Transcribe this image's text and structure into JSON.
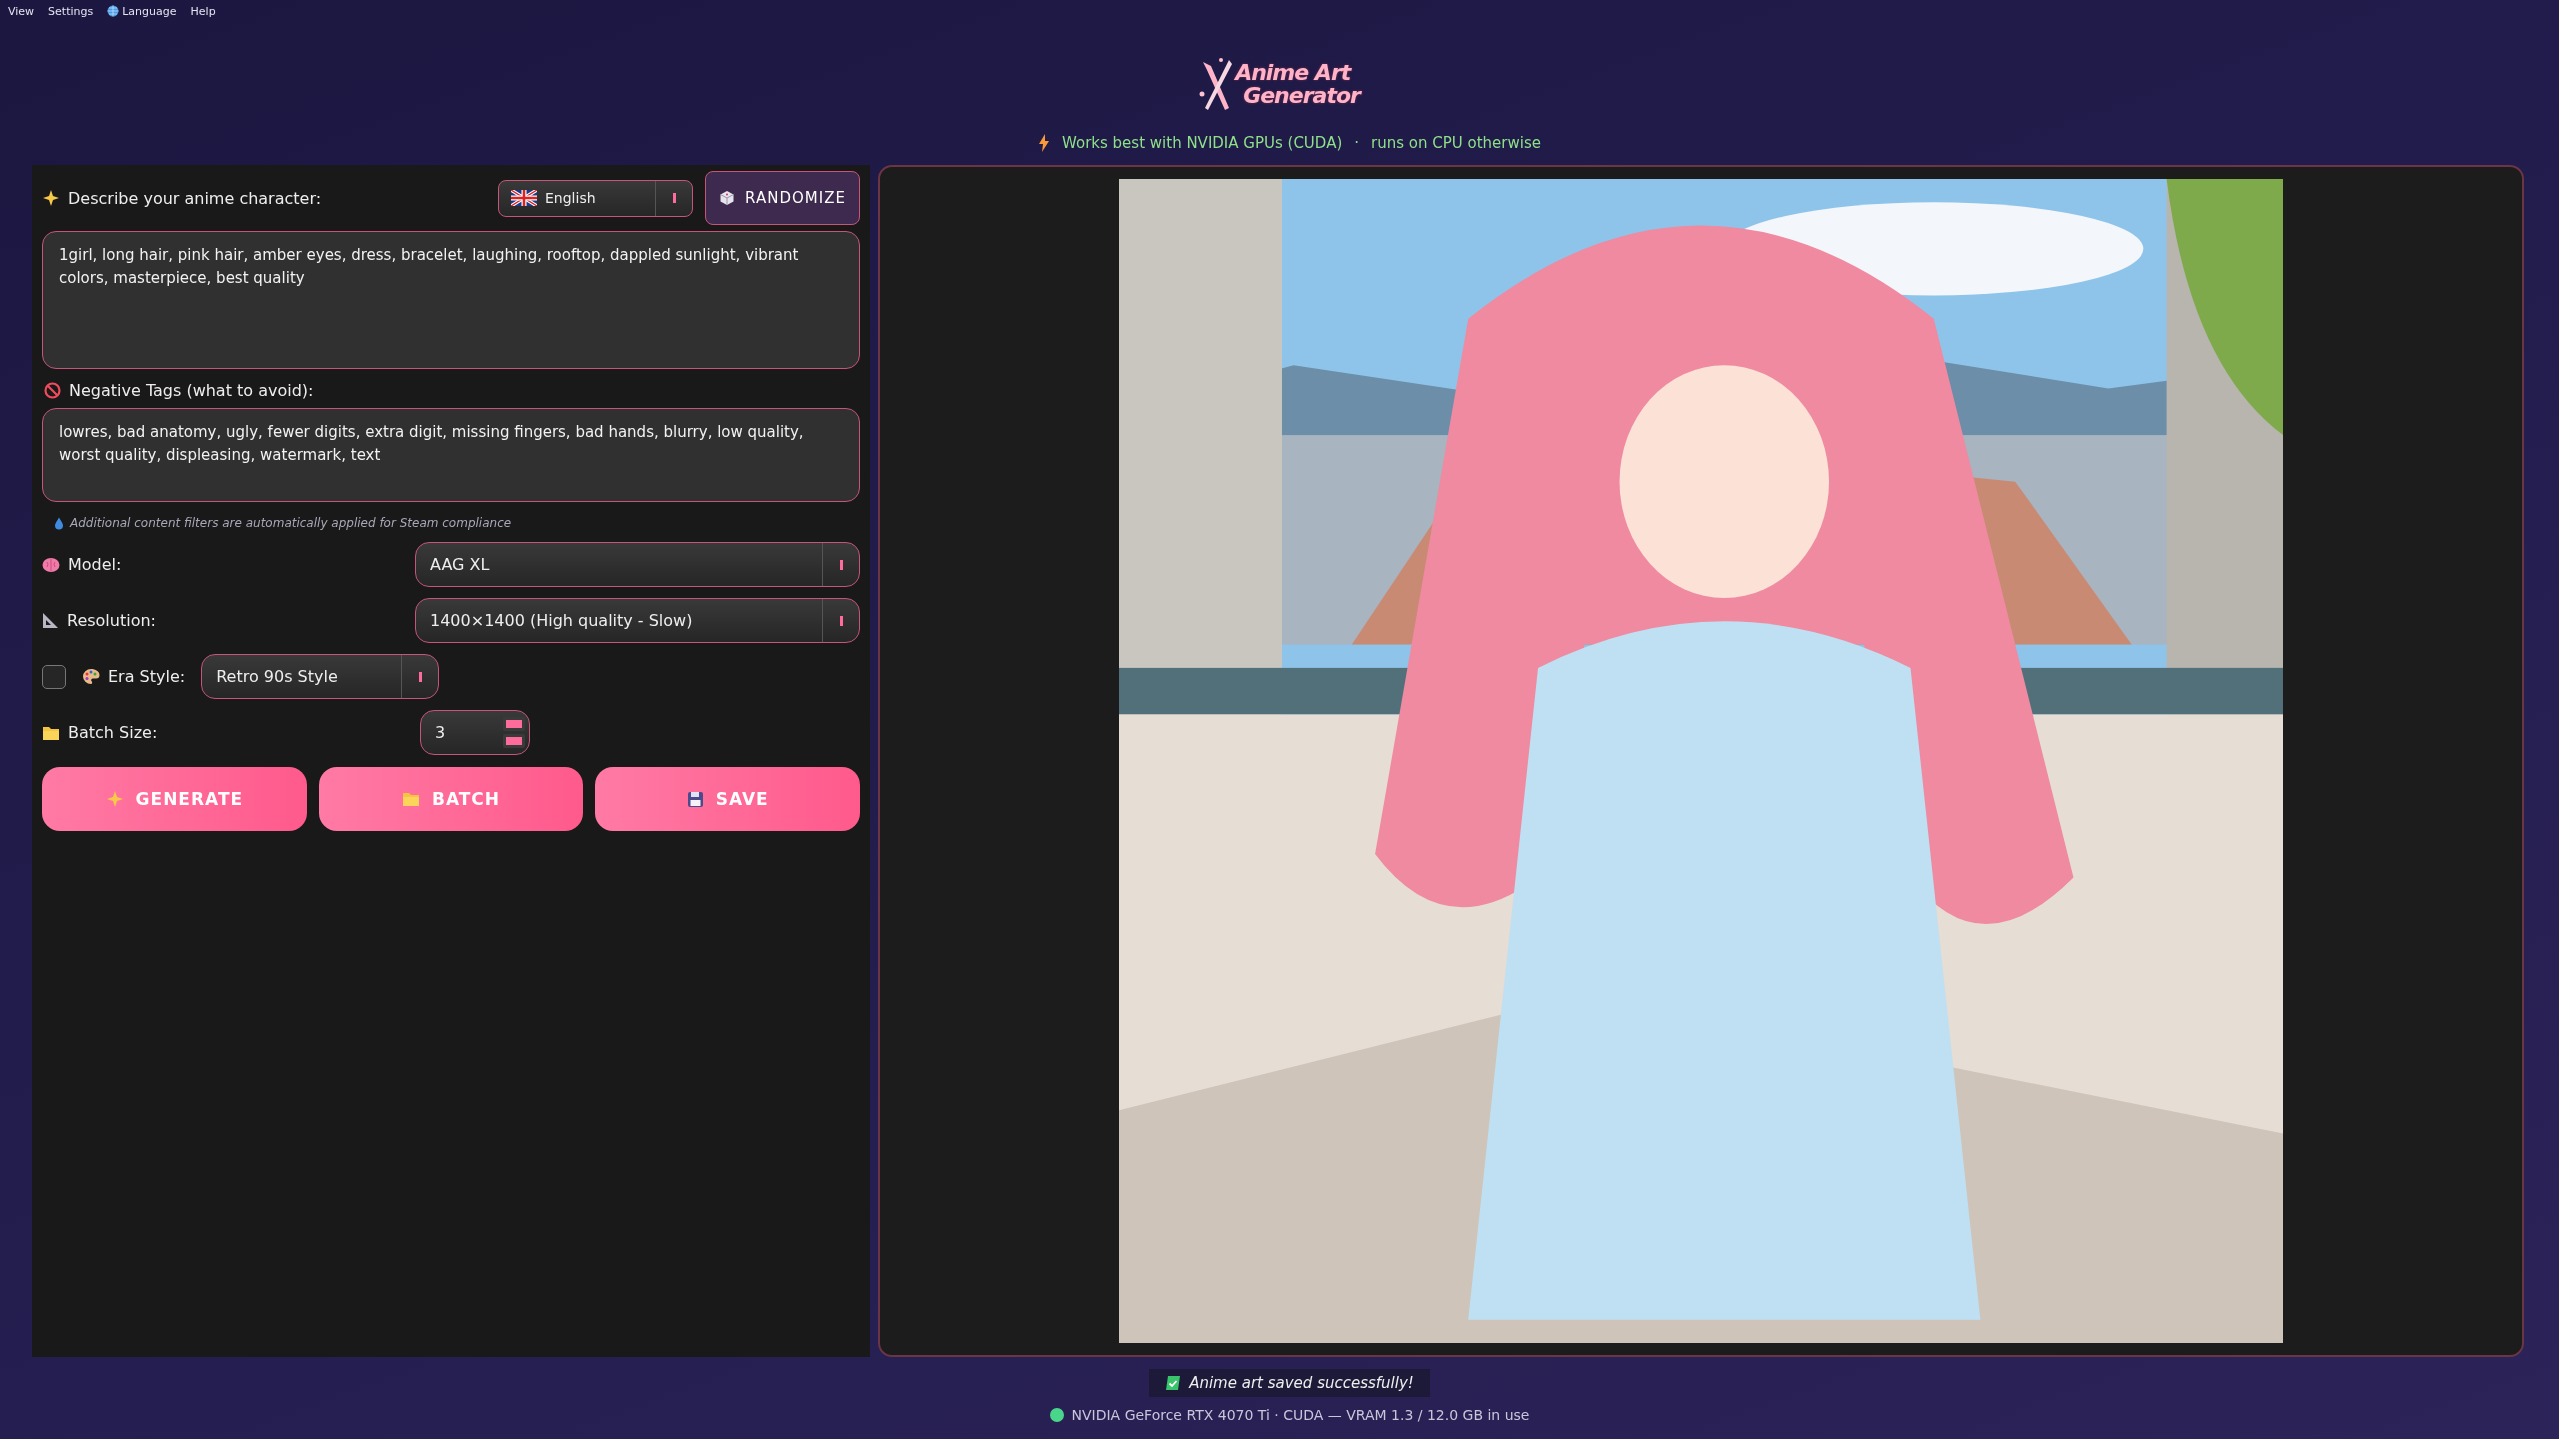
{
  "menu": [
    {
      "label": "View",
      "kind": "text"
    },
    {
      "label": "Settings",
      "kind": "text"
    },
    {
      "label": "Language",
      "kind": "globe"
    },
    {
      "label": "Help",
      "kind": "text"
    }
  ],
  "logo": {
    "line1": "Anime Art",
    "line2": "Generator"
  },
  "notice": {
    "text": "Works best with NVIDIA GPUs (CUDA)",
    "separator": "·",
    "text2": "runs on CPU otherwise"
  },
  "prompt": {
    "label": "Describe your anime character:",
    "language": "English",
    "randomize": "RANDOMIZE",
    "value": "1girl, long hair, pink hair, amber eyes, dress, bracelet, laughing, rooftop, dappled sunlight, vibrant colors, masterpiece, best quality"
  },
  "negative": {
    "label": "Negative Tags (what to avoid):",
    "value": "lowres, bad anatomy, ugly, fewer digits, extra digit, missing fingers, bad hands, blurry, low quality, worst quality, displeasing, watermark, text"
  },
  "filter_note": "Additional content filters are automatically applied for Steam compliance",
  "settings": [
    {
      "kind": "select",
      "label": "Model:",
      "value": "AAG XL"
    },
    {
      "kind": "select",
      "label": "Resolution:",
      "value": "1400×1400 (High quality - Slow)"
    },
    {
      "kind": "toggle_select",
      "label": "Era Style:",
      "checked": false,
      "value": "Retro 90s Style"
    },
    {
      "kind": "spin",
      "label": "Batch Size:",
      "value": "3"
    }
  ],
  "buttons": [
    {
      "label": "GENERATE",
      "kind": "sparkle"
    },
    {
      "label": "BATCH",
      "kind": "folder"
    },
    {
      "label": "SAVE",
      "kind": "disk"
    }
  ],
  "toast": "Anime art saved successfully!",
  "status": "NVIDIA GeForce RTX 4070 Ti · CUDA — VRAM 1.3 / 12.0 GB in use"
}
